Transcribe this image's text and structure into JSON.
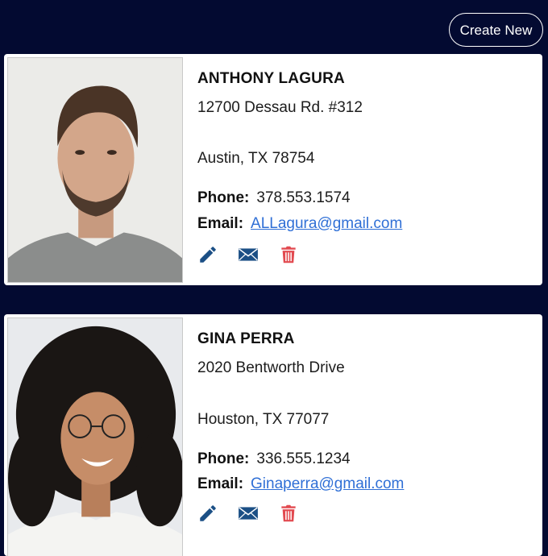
{
  "header": {
    "create_label": "Create New"
  },
  "contacts": [
    {
      "name": "ANTHONY LAGURA",
      "address1": "12700 Dessau Rd. #312",
      "address2": "Austin, TX 78754",
      "phone_label": "Phone:",
      "phone": "378.553.1574",
      "email_label": "Email:",
      "email": "ALLagura@gmail.com"
    },
    {
      "name": "GINA PERRA",
      "address1": "2020 Bentworth Drive",
      "address2": "Houston, TX 77077",
      "phone_label": "Phone:",
      "phone": "336.555.1234",
      "email_label": "Email:",
      "email": "Ginaperra@gmail.com"
    }
  ],
  "icons": {
    "edit": "pencil-icon",
    "mail": "envelope-icon",
    "delete": "trash-icon"
  },
  "colors": {
    "background": "#030a31",
    "edit_icon": "#1b4f85",
    "mail_icon": "#1b4f85",
    "delete_icon": "#e24a50",
    "link": "#2f6fd6"
  }
}
